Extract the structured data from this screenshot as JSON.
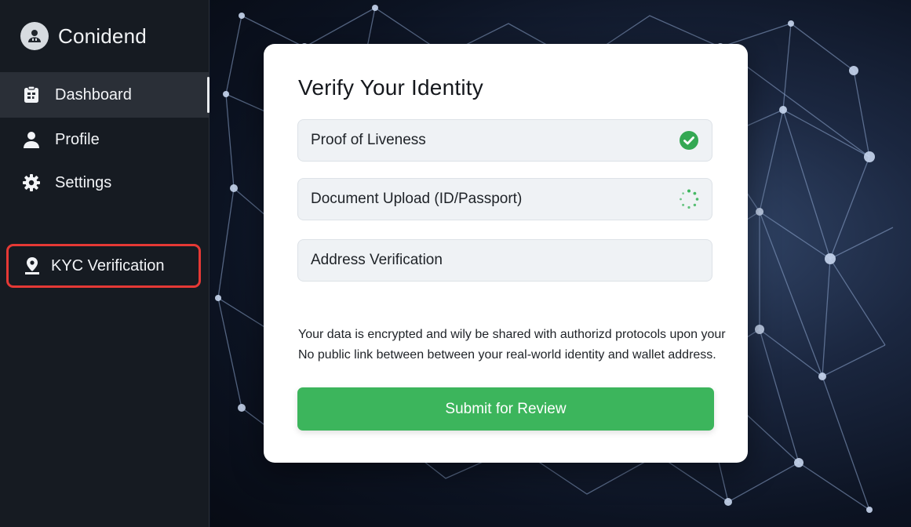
{
  "brand": {
    "name": "Conidend",
    "icon": "user-group-icon"
  },
  "sidebar": {
    "items": [
      {
        "label": "Dashboard",
        "icon": "dashboard-icon",
        "active": true
      },
      {
        "label": "Profile",
        "icon": "user-icon",
        "active": false
      },
      {
        "label": "Settings",
        "icon": "gear-icon",
        "active": false
      }
    ],
    "kyc": {
      "label": "KYC Verification",
      "icon": "location-pin-icon",
      "highlight_color": "#e53935"
    }
  },
  "card": {
    "title": "Verify Your Identity",
    "steps": [
      {
        "label": "Proof of Liveness",
        "status": "complete",
        "icon": "check-circle-icon"
      },
      {
        "label": "Document Upload (ID/Passport)",
        "status": "in-progress",
        "icon": "spinner-icon"
      },
      {
        "label": "Address Verification",
        "status": "pending",
        "icon": ""
      }
    ],
    "info_line1": "Your data is encrypted and wily be shared with authorizd protocols upon your",
    "info_line2": "No public link between between your real-world identity and wallet address.",
    "submit_label": "Submit for Review"
  },
  "colors": {
    "accent_green": "#3cb55c",
    "sidebar_bg": "#161b22",
    "highlight_red": "#e53935"
  }
}
